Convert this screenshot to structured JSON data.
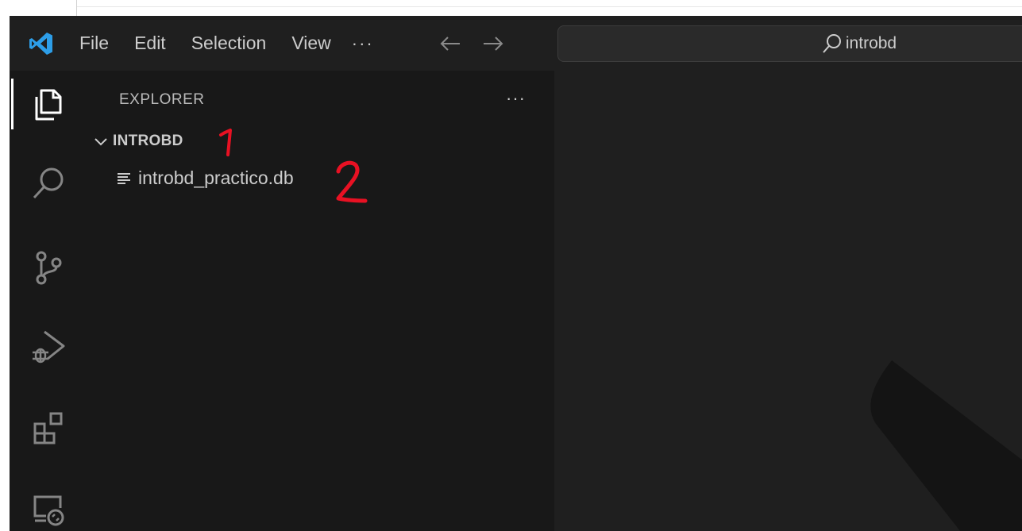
{
  "titlebar": {
    "menu": [
      "File",
      "Edit",
      "Selection",
      "View"
    ],
    "more": "···",
    "search_text": "introbd",
    "icons": [
      "vscode-logo-icon",
      "arrow-left-icon",
      "arrow-right-icon",
      "search-icon"
    ]
  },
  "activity_bar": {
    "items": [
      "explorer",
      "search",
      "source-control",
      "run-and-debug",
      "extensions",
      "remote-explorer"
    ],
    "active": "explorer"
  },
  "sidebar": {
    "header": "EXPLORER",
    "more": "···",
    "folder": "INTROBD",
    "file": "introbd_practico.db"
  },
  "annotations": {
    "one": "1",
    "two": "2",
    "color": "#e81123"
  },
  "colors": {
    "titlebar_bg": "#1f1f1f",
    "sidebar_bg": "#181818",
    "editor_bg": "#1f1f1f",
    "accent": "#0078d4"
  }
}
